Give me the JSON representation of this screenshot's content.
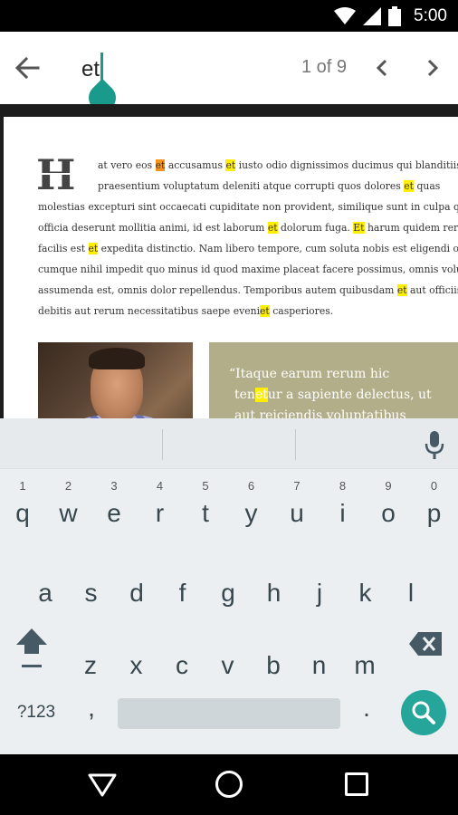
{
  "status_bar": {
    "time": "5:00",
    "icons": [
      "wifi-icon",
      "signal-icon",
      "battery-icon"
    ]
  },
  "search_bar": {
    "query": "et",
    "match_count": "1 of 9",
    "accent_color": "#1a9a8a"
  },
  "document": {
    "dropcap": "H",
    "lines": [
      [
        "at vero eos ",
        {
          "hl": "et",
          "current": true
        },
        " accusamus ",
        {
          "hl": "et"
        },
        " iusto odio dignissimos ducimus qui blanditiis"
      ],
      [
        "praesentium voluptatum deleniti atque corrupti quos dolores ",
        {
          "hl": "et"
        },
        " quas"
      ],
      [
        "molestias excepturi sint occaecati cupiditate non provident, similique sunt in culpa qui"
      ],
      [
        "officia deserunt mollitia animi, id est laborum ",
        {
          "hl": "et"
        },
        " dolorum fuga. ",
        {
          "hl": "Et"
        },
        " harum quidem rerum"
      ],
      [
        "facilis est ",
        {
          "hl": "et"
        },
        " expedita distinctio. Nam libero tempore, cum soluta nobis est eligendi optio"
      ],
      [
        "cumque nihil impedit quo minus id quod maxime placeat facere possimus, omnis voluptas"
      ],
      [
        "assumenda est, omnis dolor repellendus. Temporibus autem quibusdam ",
        {
          "hl": "et"
        },
        " aut officiis"
      ],
      [
        "debitis aut rerum necessitatibus saepe eveni",
        {
          "hl": "et"
        },
        " casperiores."
      ]
    ],
    "quote": {
      "line1": "“Itaque earum rerum hic",
      "line2_pre": "ten",
      "line2_hl": "et",
      "line2_post": "ur a sapiente delectus, ut",
      "line3": "aut reiciendis voluptatibus"
    },
    "highlight_color": "#ffee00",
    "current_highlight_color": "#f7941d",
    "quote_bg_color": "#b3ae8a"
  },
  "keyboard": {
    "row1": [
      {
        "ch": "q",
        "hint": "1"
      },
      {
        "ch": "w",
        "hint": "2"
      },
      {
        "ch": "e",
        "hint": "3"
      },
      {
        "ch": "r",
        "hint": "4"
      },
      {
        "ch": "t",
        "hint": "5"
      },
      {
        "ch": "y",
        "hint": "6"
      },
      {
        "ch": "u",
        "hint": "7"
      },
      {
        "ch": "i",
        "hint": "8"
      },
      {
        "ch": "o",
        "hint": "9"
      },
      {
        "ch": "p",
        "hint": "0"
      }
    ],
    "row2": [
      "a",
      "s",
      "d",
      "f",
      "g",
      "h",
      "j",
      "k",
      "l"
    ],
    "row3": [
      "z",
      "x",
      "c",
      "v",
      "b",
      "n",
      "m"
    ],
    "symbols_label": "?123",
    "comma": ",",
    "period": ".",
    "action_color": "#26a69a"
  }
}
